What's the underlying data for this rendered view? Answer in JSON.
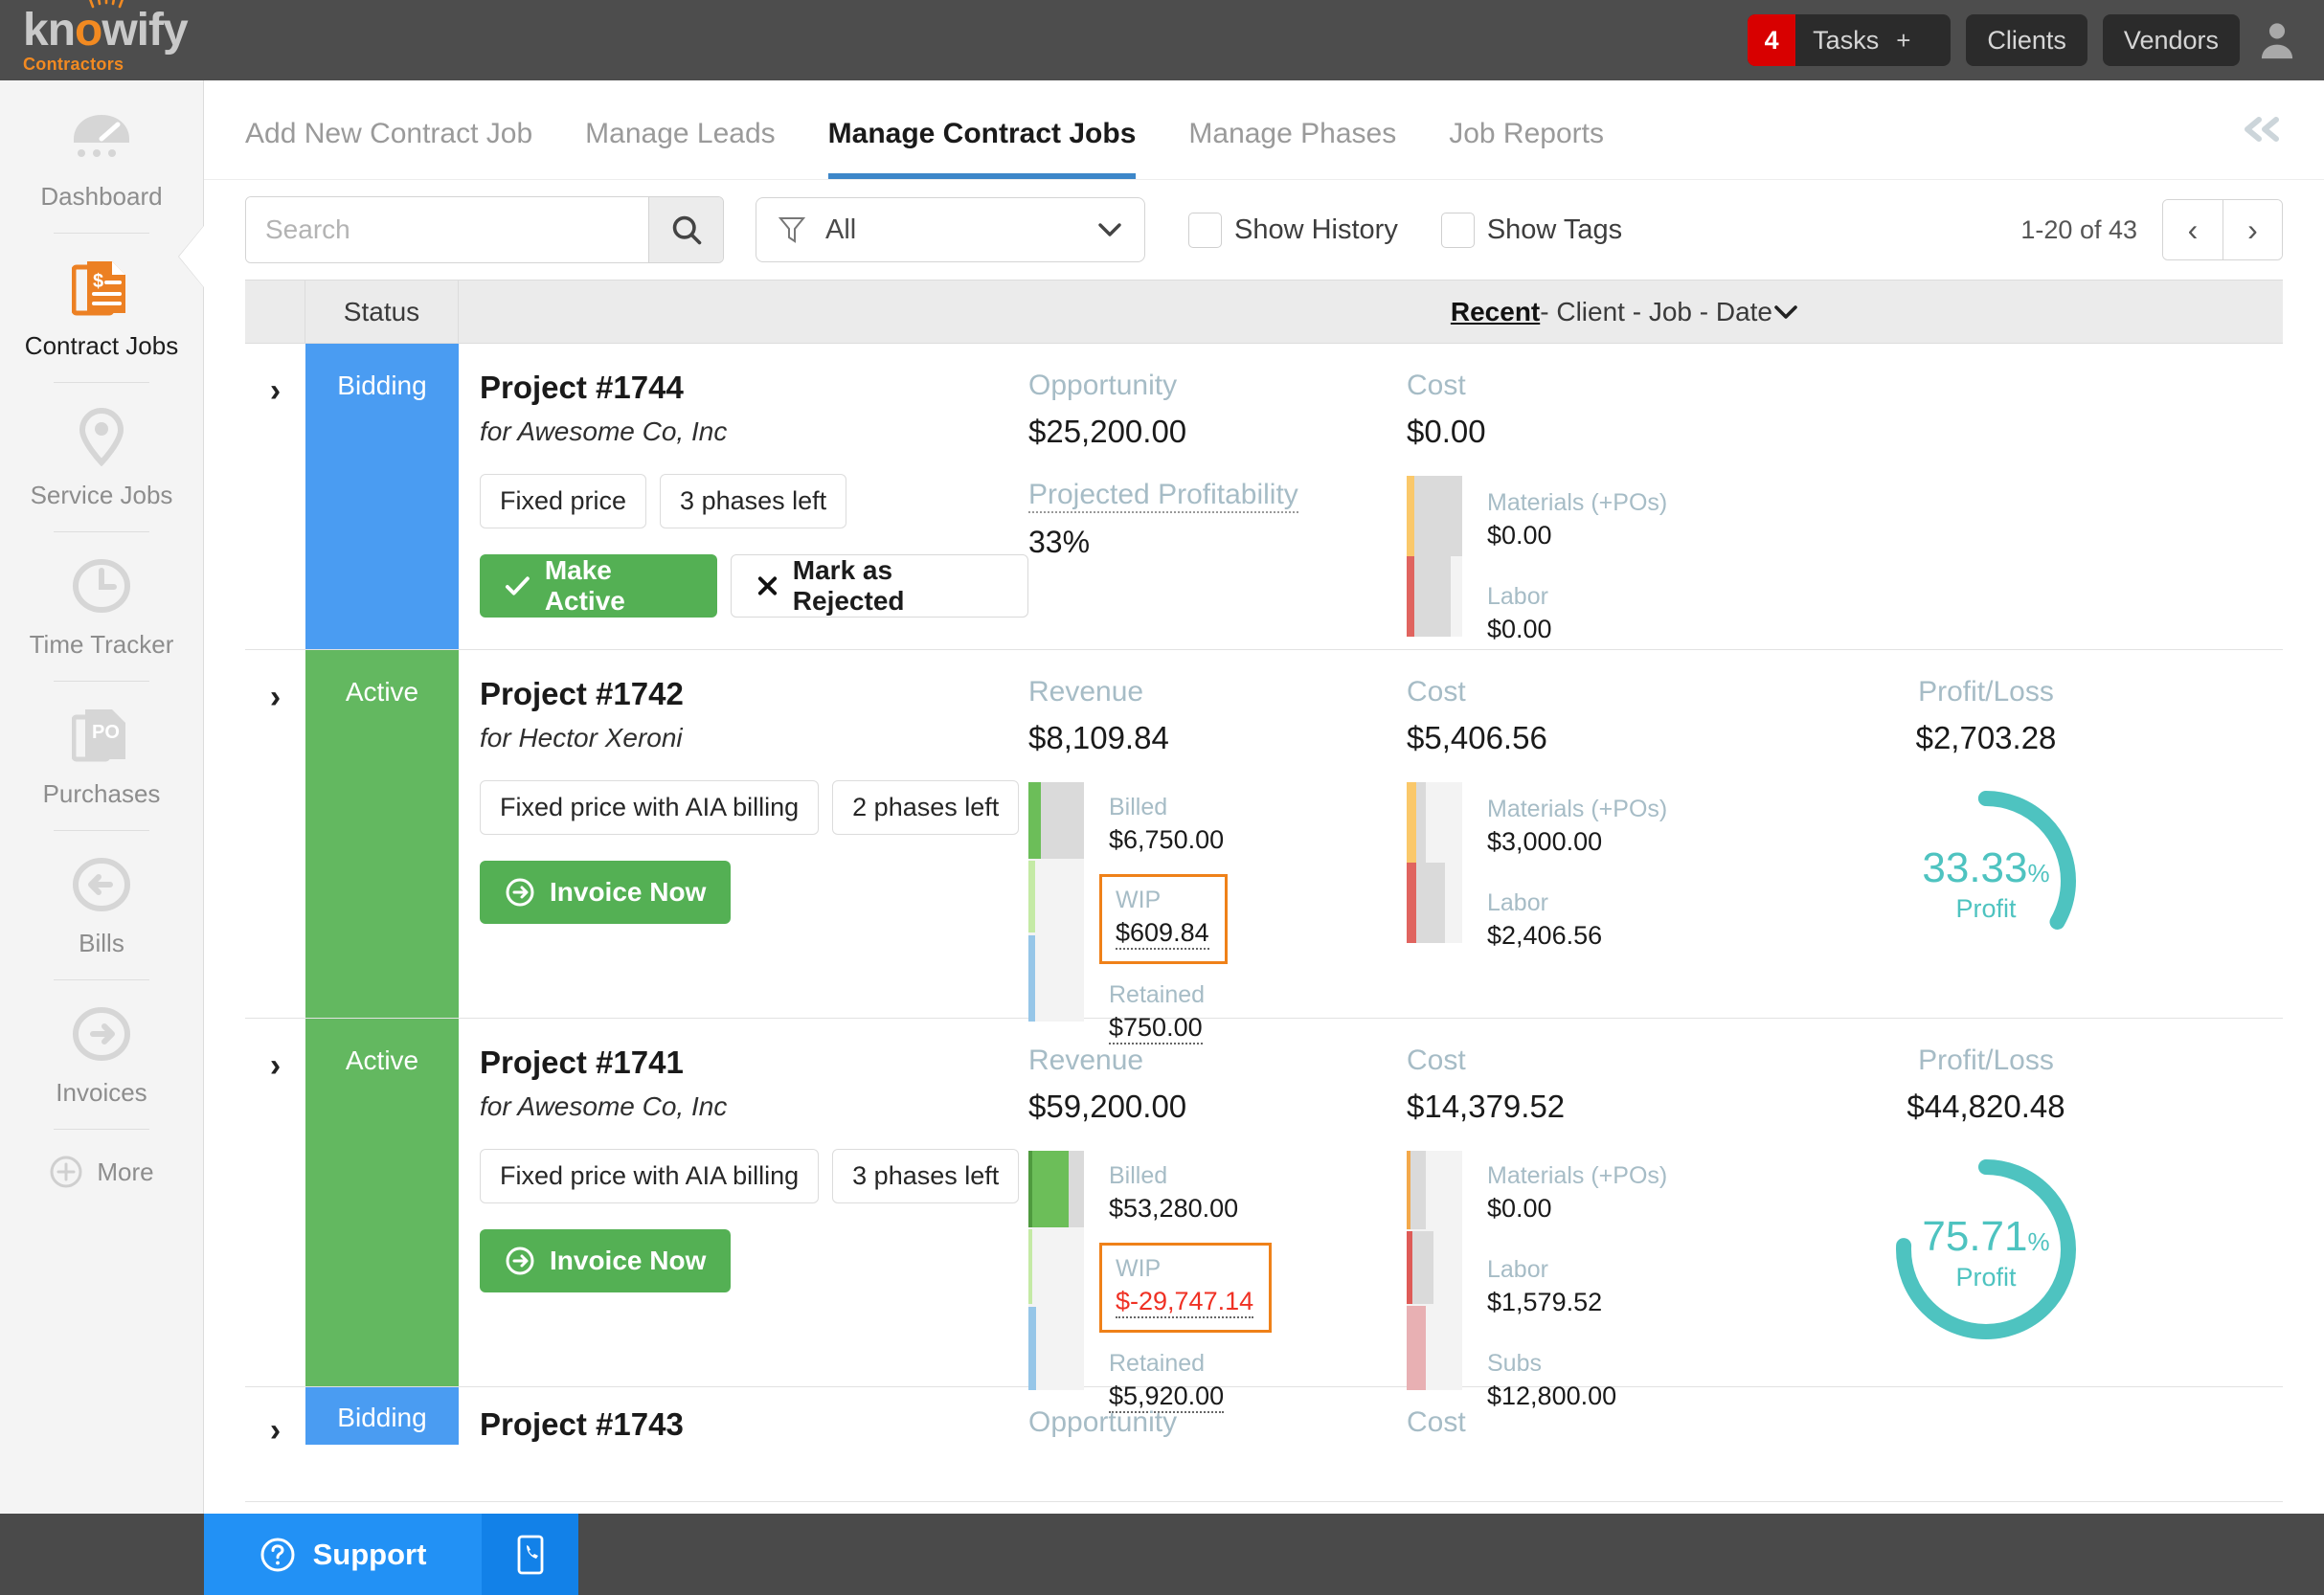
{
  "brand": {
    "name_part1": "kn",
    "name_o": "o",
    "name_part2": "wify",
    "subtitle": "Contractors"
  },
  "topbar": {
    "tasks_badge": "4",
    "tasks_label": "Tasks",
    "tasks_plus": "+",
    "clients": "Clients",
    "vendors": "Vendors"
  },
  "sidebar": {
    "items": [
      {
        "label": "Dashboard",
        "icon": "dashboard-gauge-icon",
        "active": false
      },
      {
        "label": "Contract Jobs",
        "icon": "contract-document-icon",
        "active": true
      },
      {
        "label": "Service Jobs",
        "icon": "map-pin-icon",
        "active": false
      },
      {
        "label": "Time Tracker",
        "icon": "clock-icon",
        "active": false
      },
      {
        "label": "Purchases",
        "icon": "po-document-icon",
        "active": false
      },
      {
        "label": "Bills",
        "icon": "arrow-left-circle-icon",
        "active": false
      },
      {
        "label": "Invoices",
        "icon": "arrow-right-circle-icon",
        "active": false
      }
    ],
    "more_label": "More"
  },
  "tabs": [
    {
      "label": "Add New Contract Job",
      "active": false
    },
    {
      "label": "Manage Leads",
      "active": false
    },
    {
      "label": "Manage Contract Jobs",
      "active": true
    },
    {
      "label": "Manage Phases",
      "active": false
    },
    {
      "label": "Job Reports",
      "active": false
    }
  ],
  "toolbar": {
    "search_placeholder": "Search",
    "search_value": "",
    "filter_value": "All",
    "show_history_label": "Show History",
    "show_tags_label": "Show Tags",
    "pager_text": "1-20 of 43",
    "prev_glyph": "‹",
    "next_glyph": "›"
  },
  "table": {
    "status_header": "Status",
    "sort_recent": "Recent",
    "sort_rest": " - Client - Job - Date ",
    "sort_caret": "⌄"
  },
  "accent_colors": {
    "bidding": "#4a9cf2",
    "active": "#63b860",
    "green_button": "#54b054",
    "orange_highlight": "#ef8119",
    "teal_donut": "#4ec3c0",
    "negative_red": "#ef3124",
    "brand_orange": "#f28a21",
    "tab_underline": "#3d87c9"
  },
  "rows": [
    {
      "expand_glyph": "›",
      "status": "Bidding",
      "status_kind": "bidding",
      "title": "Project #1744",
      "client": "for Awesome Co, Inc",
      "pills": [
        "Fixed price",
        "3 phases left"
      ],
      "actions": [
        {
          "label": "Make Active",
          "kind": "green",
          "icon": "check-icon"
        },
        {
          "label": "Mark as Rejected",
          "kind": "white",
          "icon": "x-icon"
        }
      ],
      "left_metric": {
        "label": "Opportunity",
        "value": "$25,200.00",
        "sub_label": "Projected Profitability",
        "sub_value": "33%"
      },
      "cost": {
        "label": "Cost",
        "value": "$0.00",
        "legend": [
          {
            "label": "Materials (+POs)",
            "value": "$0.00"
          },
          {
            "label": "Labor",
            "value": "$0.00"
          }
        ]
      },
      "profit": null
    },
    {
      "expand_glyph": "›",
      "status": "Active",
      "status_kind": "active",
      "title": "Project #1742",
      "client": "for Hector Xeroni",
      "pills": [
        "Fixed price with AIA billing",
        "2 phases left"
      ],
      "actions": [
        {
          "label": "Invoice Now",
          "kind": "green",
          "icon": "arrow-right-circle-icon"
        }
      ],
      "revenue": {
        "label": "Revenue",
        "value": "$8,109.84",
        "legend": [
          {
            "label": "Billed",
            "value": "$6,750.00",
            "style": "plain"
          },
          {
            "label": "WIP",
            "value": "$609.84",
            "style": "boxed"
          },
          {
            "label": "Retained",
            "value": "$750.00",
            "style": "dotted"
          }
        ]
      },
      "cost": {
        "label": "Cost",
        "value": "$5,406.56",
        "legend": [
          {
            "label": "Materials (+POs)",
            "value": "$3,000.00"
          },
          {
            "label": "Labor",
            "value": "$2,406.56"
          }
        ]
      },
      "profit": {
        "label": "Profit/Loss",
        "value": "$2,703.28",
        "percent": "33.33",
        "percent_symbol": "%",
        "sub": "Profit"
      }
    },
    {
      "expand_glyph": "›",
      "status": "Active",
      "status_kind": "active",
      "title": "Project #1741",
      "client": "for Awesome Co, Inc",
      "pills": [
        "Fixed price with AIA billing",
        "3 phases left"
      ],
      "actions": [
        {
          "label": "Invoice Now",
          "kind": "green",
          "icon": "arrow-right-circle-icon"
        }
      ],
      "revenue": {
        "label": "Revenue",
        "value": "$59,200.00",
        "legend": [
          {
            "label": "Billed",
            "value": "$53,280.00",
            "style": "plain"
          },
          {
            "label": "WIP",
            "value": "$-29,747.14",
            "style": "boxed-neg"
          },
          {
            "label": "Retained",
            "value": "$5,920.00",
            "style": "dotted"
          }
        ]
      },
      "cost": {
        "label": "Cost",
        "value": "$14,379.52",
        "legend": [
          {
            "label": "Materials (+POs)",
            "value": "$0.00"
          },
          {
            "label": "Labor",
            "value": "$1,579.52"
          },
          {
            "label": "Subs",
            "value": "$12,800.00"
          }
        ]
      },
      "profit": {
        "label": "Profit/Loss",
        "value": "$44,820.48",
        "percent": "75.71",
        "percent_symbol": "%",
        "sub": "Profit"
      }
    },
    {
      "expand_glyph": "›",
      "status": "Bidding",
      "status_kind": "bidding",
      "title": "Project #1743",
      "client": "",
      "pills": [],
      "actions": [],
      "left_metric": {
        "label": "Opportunity",
        "value": "",
        "sub_label": "",
        "sub_value": ""
      },
      "cost": {
        "label": "Cost",
        "value": "",
        "legend": []
      },
      "profit": null
    }
  ],
  "support": {
    "label": "Support",
    "help_icon": "question-circle-icon",
    "phone_icon": "mobile-phone-icon"
  }
}
